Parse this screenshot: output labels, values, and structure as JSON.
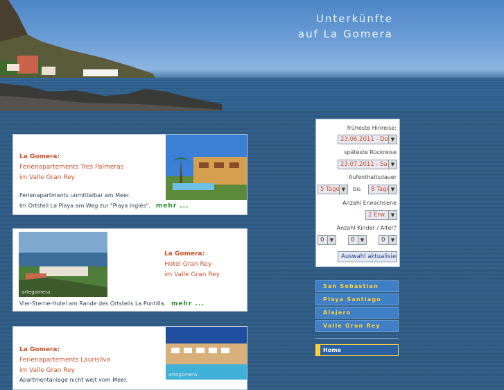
{
  "header": {
    "title_line1": "Unterkünfte",
    "title_line2": "auf La Gomera"
  },
  "cards": [
    {
      "heading": "La Gomera:",
      "line1": "Ferienapartements Tres Palmeras",
      "line2": "im Valle Gran Rey",
      "desc1": "Ferienapartments unmittelbar am Meer.",
      "desc2": "Im Ortsteil La Playa am Weg zur \"Playa Inglés\".",
      "more": "mehr ..."
    },
    {
      "heading": "La Gomera:",
      "line1": "Hotel Gran Rey",
      "line2": "im Valle Gran Rey",
      "desc1": "Vier-Sterne-Hotel am Rande des Ortsteils La Puntilla.",
      "more": "mehr ...",
      "photo_credit": "artegomera"
    },
    {
      "heading": "La Gomera:",
      "line1": "Ferienapartements Laurisilva",
      "line2": "im Valle Gran Rey",
      "desc1": "Apartmentanlage nicht weit vom Meer.",
      "photo_credit": "artegomera"
    }
  ],
  "search": {
    "earliest_label": "früheste Hinreise:",
    "earliest_value": "23.06.2011 - Do",
    "latest_label": "späteste Rückreise",
    "latest_value": "23.07.2011 - Sa",
    "stay_label": "Aufenthaltsdauer",
    "stay_from": "5 Tage",
    "stay_bis": "bis",
    "stay_to": "8 Tage",
    "adults_label": "Anzahl Erwachsene",
    "adults_value": "2 Erw.",
    "kids_label": "Anzahl Kinder / Alter?",
    "kid1": "0",
    "kid2": "0",
    "kid3": "0",
    "submit_label": "Auswahl aktualisieren"
  },
  "nav": {
    "items": [
      "San Sebastian",
      "Playa Santiago",
      "Alajero",
      "Valle Gran Rey"
    ],
    "home": "Home"
  },
  "colors": {
    "accent_orange": "#c8512a",
    "more_green": "#2a8f2a",
    "nav_blue": "#3f7fc6",
    "nav_text": "#ffd23a"
  }
}
